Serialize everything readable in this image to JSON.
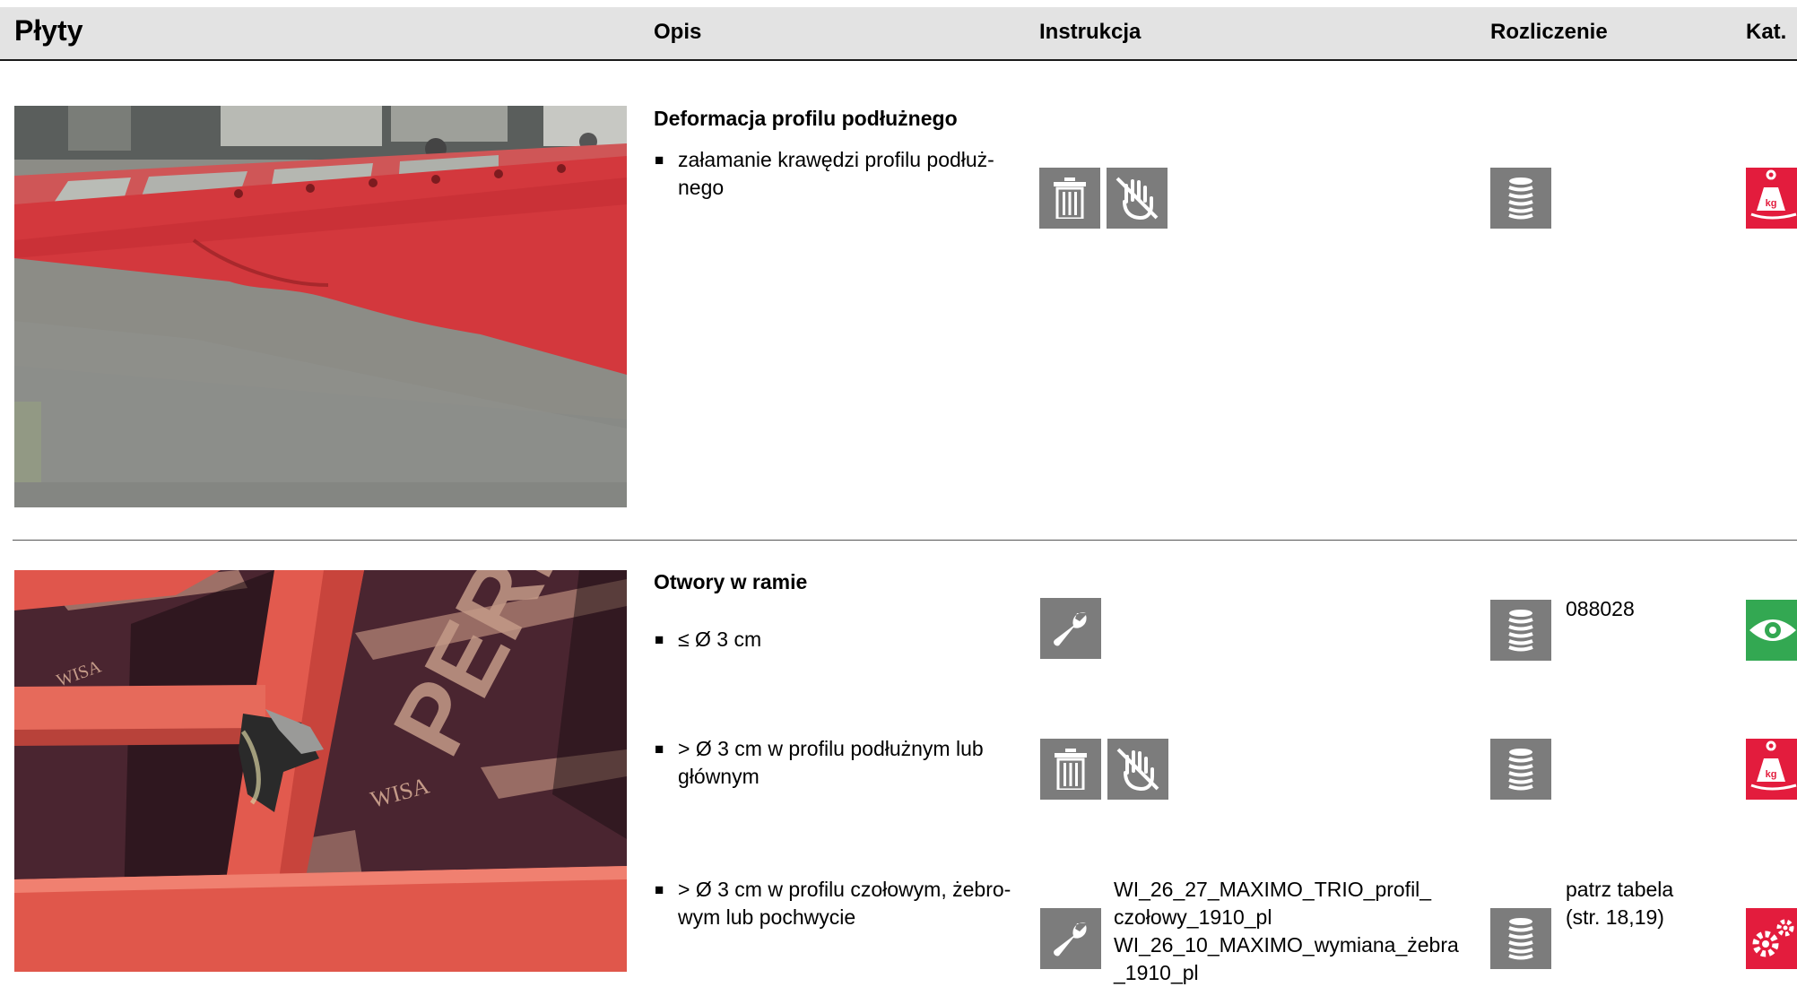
{
  "header": {
    "title": "Płyty",
    "col_opis": "Opis",
    "col_instrukcja": "Instrukcja",
    "col_rozliczenie": "Rozliczenie",
    "col_kat": "Kat."
  },
  "sections": [
    {
      "title": "Deformacja profilu podłużnego",
      "items": [
        {
          "bullet": "■",
          "text": "załamanie krawędzi profilu podłuż-nego",
          "instruction_icons": [
            "trash-icon",
            "no-touch-hand-icon"
          ],
          "settlement_icon": "stack-icon",
          "settlement_text": "",
          "category": {
            "icon": "weight-kg-icon",
            "color": "#e31c3d"
          }
        }
      ]
    },
    {
      "title": "Otwory w ramie",
      "items": [
        {
          "bullet": "■",
          "text": "≤ Ø 3 cm",
          "instruction_icons": [
            "wrench-icon"
          ],
          "settlement_icon": "stack-icon",
          "settlement_text": "088028",
          "category": {
            "icon": "eye-icon",
            "color": "#33a852"
          }
        },
        {
          "bullet": "■",
          "text": "> Ø 3 cm w profilu podłużnym lub głównym",
          "instruction_icons": [
            "trash-icon",
            "no-touch-hand-icon"
          ],
          "settlement_icon": "stack-icon",
          "settlement_text": "",
          "category": {
            "icon": "weight-kg-icon",
            "color": "#e31c3d"
          }
        },
        {
          "bullet": "■",
          "text": "> Ø 3 cm w profilu czołowym, żebro-wym lub pochwycie",
          "instruction_icons": [
            "wrench-icon"
          ],
          "instruction_text": [
            "WI_26_27_MAXIMO_TRIO_profil_",
            "czołowy_1910_pl",
            "WI_26_10_MAXIMO_wymiana_żebra",
            "_1910_pl"
          ],
          "settlement_icon": "stack-icon",
          "settlement_text": [
            "patrz tabela",
            "(str. 18,19)"
          ],
          "category": {
            "icon": "gears-icon",
            "color": "#e31c3d"
          }
        }
      ]
    }
  ],
  "photos": {
    "photo1": {
      "text": "",
      "name": "deformed-longitudinal-profile-photo"
    },
    "photo2": {
      "text": "WISA",
      "text_large": "PERI",
      "name": "frame-holes-photo"
    }
  }
}
